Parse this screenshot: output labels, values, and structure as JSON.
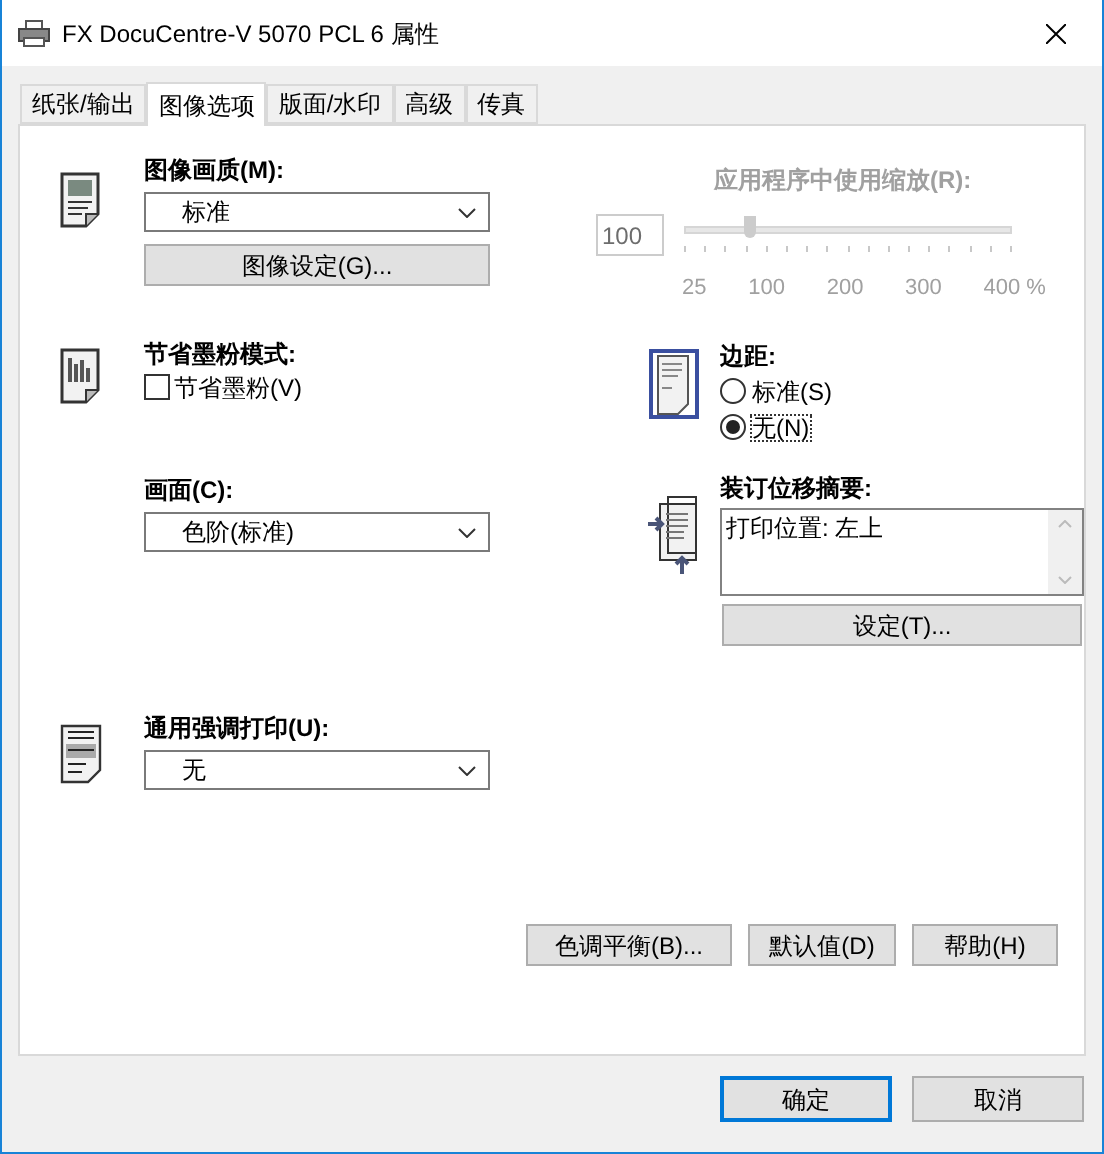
{
  "window": {
    "title": "FX DocuCentre-V 5070 PCL 6 属性"
  },
  "tabs": [
    {
      "label": "纸张/输出",
      "selected": false
    },
    {
      "label": "图像选项",
      "selected": true
    },
    {
      "label": "版面/水印",
      "selected": false
    },
    {
      "label": "高级",
      "selected": false
    },
    {
      "label": "传真",
      "selected": false
    }
  ],
  "image_quality": {
    "label": "图像画质(M):",
    "value": "标准",
    "button": "图像设定(G)..."
  },
  "app_scaling": {
    "label": "应用程序中使用缩放(R):",
    "disabled": true,
    "value": "100",
    "level": 0.2,
    "tick_labels": [
      "25",
      "100",
      "200",
      "300",
      "400 %"
    ]
  },
  "toner_save": {
    "label": "节省墨粉模式:",
    "checkbox": {
      "label": "节省墨粉(V)",
      "checked": false
    }
  },
  "margins": {
    "label": "边距:",
    "options": [
      {
        "label": "标准(S)",
        "selected": false
      },
      {
        "label": "无(N)",
        "selected": true
      }
    ]
  },
  "screen": {
    "label": "画面(C):",
    "value": "色阶(标准)"
  },
  "binding_shift": {
    "label": "装订位移摘要:",
    "summary": "打印位置: 左上",
    "button": "设定(T)..."
  },
  "emphasis": {
    "label": "通用强调打印(U):",
    "value": "无"
  },
  "panel_buttons": [
    "色调平衡(B)...",
    "默认值(D)",
    "帮助(H)"
  ],
  "dialog_buttons": [
    {
      "label": "确定",
      "default": true
    },
    {
      "label": "取消",
      "default": false
    }
  ]
}
